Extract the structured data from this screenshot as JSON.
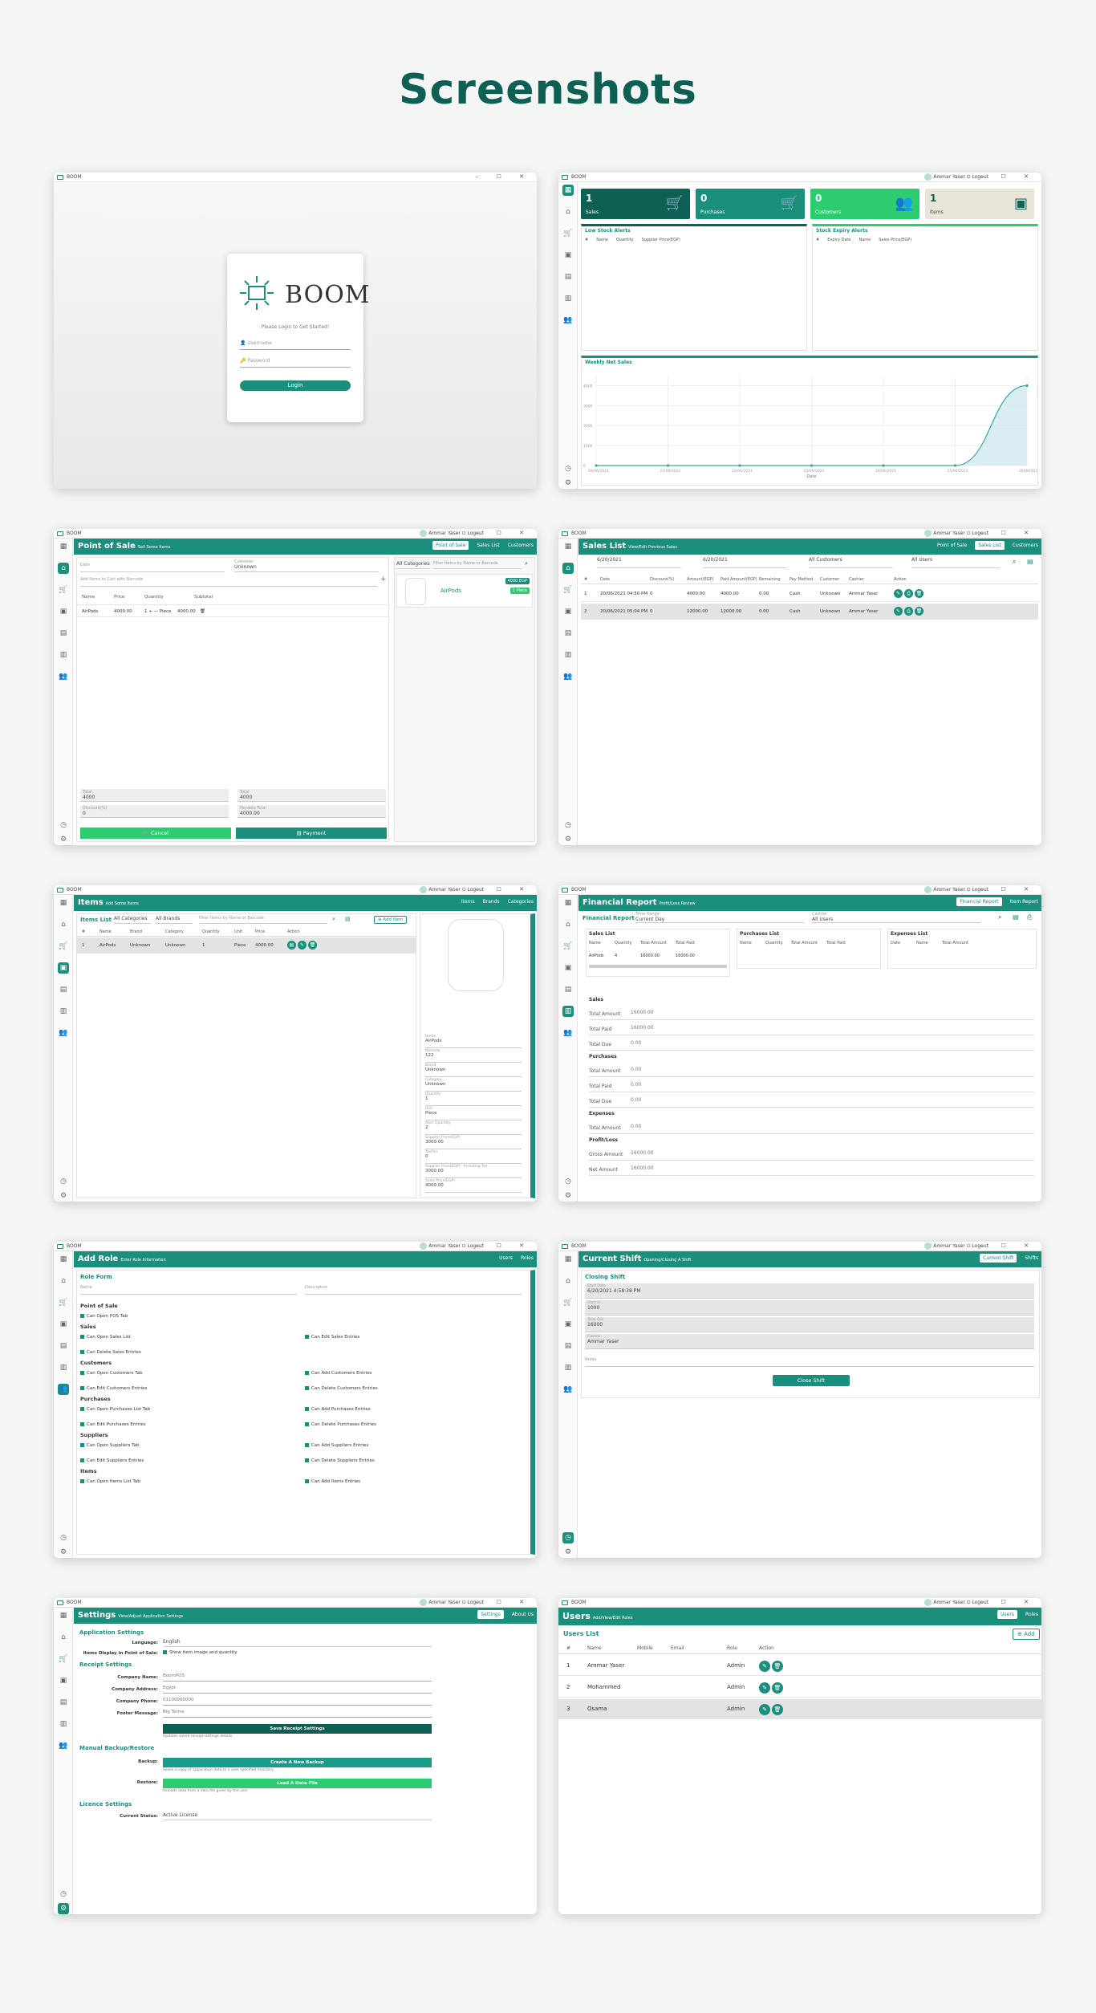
{
  "page_title": "Screenshots",
  "app": {
    "window_title": "BOOM",
    "user": "Ammar Yaser",
    "logout": "Logout",
    "window_controls": "–  ☐  ✕"
  },
  "login": {
    "logo_text": "BOOM",
    "message": "Please Login to Get Started!",
    "username_placeholder": "Username",
    "password_placeholder": "Password",
    "login_button": "Login"
  },
  "dashboard": {
    "cards": [
      {
        "value": "1",
        "label": "Sales",
        "color": "#0e5f54"
      },
      {
        "value": "0",
        "label": "Purchases",
        "color": "#1a8f7c"
      },
      {
        "value": "0",
        "label": "Customers",
        "color": "#2ecc71"
      },
      {
        "value": "1",
        "label": "Items",
        "color": "#e8e4d8"
      }
    ],
    "low_stock": {
      "title": "Low Stock Alerts",
      "columns": [
        "#",
        "Name",
        "Quantity",
        "Supplier Price(EGP)"
      ]
    },
    "expiry": {
      "title": "Stock Expiry Alerts",
      "columns": [
        "#",
        "Expiry Date",
        "Name",
        "Sales Price(EGP)"
      ]
    },
    "chart_title": "Weekly Net Sales",
    "x_label": "Date",
    "y_ticks": [
      "4000",
      "3000",
      "2000",
      "1000",
      "0"
    ]
  },
  "chart_data": {
    "type": "line",
    "title": "Weekly Net Sales",
    "xlabel": "Date",
    "ylabel": "",
    "x": [
      "20/06/2021",
      "21/06/2021",
      "22/06/2021",
      "23/06/2021",
      "24/06/2021",
      "25/06/2021",
      "26/06/2021"
    ],
    "values": [
      0,
      0,
      0,
      0,
      0,
      0,
      4000
    ],
    "ylim": [
      0,
      4500
    ]
  },
  "pos": {
    "title": "Point of Sale",
    "subtitle": "Sell Some Items",
    "nav": [
      "Point of Sale",
      "Sales List",
      "Customers"
    ],
    "date_placeholder": "Date",
    "customer_label": "Customer",
    "customer_value": "Unknown",
    "barcode_placeholder": "Add Items to Cart with Barcode",
    "columns": [
      "Name",
      "Price",
      "Quantity",
      "Subtotal"
    ],
    "row": {
      "name": "AirPods",
      "price": "4000.00",
      "qty": "1",
      "unit": "Piece",
      "subtotal": "4000.00"
    },
    "category": "All Categories",
    "search_placeholder": "Filter Items by Name or Barcode",
    "item": {
      "name": "AirPods",
      "price": "4000 EGP",
      "stock": "1 Piece"
    },
    "totals": {
      "total_label": "Total",
      "total": "4000",
      "discount_label": "Discount(%)",
      "discount": "0",
      "payable_label": "Payable Total",
      "payable": "4000.00"
    },
    "cancel": "Cancel",
    "payment": "Payment"
  },
  "sales": {
    "title": "Sales List",
    "subtitle": "View/Edit Previous Sales",
    "nav": [
      "Point of Sale",
      "Sales List",
      "Customers"
    ],
    "from": "6/20/2021",
    "to": "6/20/2021",
    "customer": "All Customers",
    "cashier": "All Users",
    "columns": [
      "#",
      "Date",
      "Discount(%)",
      "Amount(EGP)",
      "Paid Amount(EGP)",
      "Remaining",
      "Pay Method",
      "Customer",
      "Cashier",
      "Action"
    ],
    "rows": [
      [
        "1",
        "20/06/2021 04:50 PM",
        "0",
        "4000.00",
        "4000.00",
        "0.00",
        "Cash",
        "Unknown",
        "Ammar Yaser"
      ],
      [
        "2",
        "20/06/2021 05:04 PM",
        "0",
        "12000.00",
        "12000.00",
        "0.00",
        "Cash",
        "Unknown",
        "Ammar Yaser"
      ]
    ]
  },
  "items": {
    "title": "Items",
    "subtitle": "Add Some Items",
    "nav": [
      "Items",
      "Brands",
      "Categories"
    ],
    "list_title": "Items List",
    "category": "All Categories",
    "brand": "All Brands",
    "search_placeholder": "Filter Items by Name or Barcode",
    "add_button": "Add Item",
    "columns": [
      "#",
      "Name",
      "Brand",
      "Category",
      "Quantity",
      "Unit",
      "Price",
      "Action"
    ],
    "row": [
      "1",
      "AirPods",
      "Unknown",
      "Unknown",
      "1",
      "Piece",
      "4000.00"
    ],
    "details": [
      {
        "label": "Name",
        "value": "AirPods"
      },
      {
        "label": "Barcode",
        "value": "122"
      },
      {
        "label": "Brand",
        "value": "Unknown"
      },
      {
        "label": "Category",
        "value": "Unknown"
      },
      {
        "label": "Quantity",
        "value": "1"
      },
      {
        "label": "Unit",
        "value": "Piece"
      },
      {
        "label": "Alert Quantity",
        "value": "2"
      },
      {
        "label": "Supplier Price(EGP)",
        "value": "3000.00"
      },
      {
        "label": "Tax(%)",
        "value": "0"
      },
      {
        "label": "Supplier Price(EGP) - Including Tax",
        "value": "3000.00"
      },
      {
        "label": "Sales Price(EGP)",
        "value": "4000.00"
      }
    ]
  },
  "finance": {
    "title": "Financial Report",
    "subtitle": "Profit/Loss Review",
    "nav": [
      "Financial Report",
      "Item Report"
    ],
    "panel_title": "Financial Report",
    "time_label": "Time Range",
    "time_value": "Current Day",
    "cashier_label": "Cashier",
    "cashier_value": "All Users",
    "sales_list": {
      "title": "Sales List",
      "columns": [
        "Name",
        "Quantity",
        "Total Amount",
        "Total Paid"
      ],
      "row": [
        "AirPods",
        "4",
        "16000.00",
        "16000.00"
      ]
    },
    "purchases_list": {
      "title": "Purchases List",
      "columns": [
        "Name",
        "Quantity",
        "Total Amount",
        "Total Paid"
      ]
    },
    "expenses_list": {
      "title": "Expenses List",
      "columns": [
        "Date",
        "Name",
        "Total Amount"
      ]
    },
    "groups": [
      {
        "title": "Sales",
        "rows": [
          [
            "Total Amount",
            "16000.00"
          ],
          [
            "Total Paid",
            "16000.00"
          ],
          [
            "Total Due",
            "0.00"
          ]
        ]
      },
      {
        "title": "Purchases",
        "rows": [
          [
            "Total Amount",
            "0.00"
          ],
          [
            "Total Paid",
            "0.00"
          ],
          [
            "Total Due",
            "0.00"
          ]
        ]
      },
      {
        "title": "Expenses",
        "rows": [
          [
            "Total Amount",
            "0.00"
          ]
        ]
      },
      {
        "title": "Profit/Loss",
        "rows": [
          [
            "Gross Amount",
            "16000.00"
          ],
          [
            "Net Amount",
            "16000.00"
          ]
        ]
      }
    ]
  },
  "role": {
    "title": "Add Role",
    "subtitle": "Enter Role Information",
    "nav": [
      "Users",
      "Roles"
    ],
    "form_title": "Role Form",
    "name_placeholder": "Name",
    "desc_placeholder": "Description",
    "groups": [
      {
        "title": "Point of Sale",
        "items": [
          "Can Open POS Tab"
        ]
      },
      {
        "title": "Sales",
        "items": [
          "Can Open Sales List",
          "Can Edit Sales Entries",
          "Can Delete Sales Entries"
        ]
      },
      {
        "title": "Customers",
        "items": [
          "Can Open Customers Tab",
          "Can Add Customers Entries",
          "Can Edit Customers Entries",
          "Can Delete Customers Entries"
        ]
      },
      {
        "title": "Purchases",
        "items": [
          "Can Open Purchases List Tab",
          "Can Add Purchases Entries",
          "Can Edit Purchases Entries",
          "Can Delete Purchases Entries"
        ]
      },
      {
        "title": "Suppliers",
        "items": [
          "Can Open Suppliers Tab",
          "Can Add Suppliers Entries",
          "Can Edit Suppliers Entries",
          "Can Delete Suppliers Entries"
        ]
      },
      {
        "title": "Items",
        "items": [
          "Can Open Items List Tab",
          "Can Add Items Entries"
        ]
      }
    ]
  },
  "shift": {
    "title": "Current Shift",
    "subtitle": "Opening/Closing A Shift",
    "nav": [
      "Current Shift",
      "Shifts"
    ],
    "panel_title": "Closing Shift",
    "fields": [
      {
        "label": "Start Date",
        "value": "6/20/2021 4:58:38 PM"
      },
      {
        "label": "Start In",
        "value": "1000"
      },
      {
        "label": "Total Out",
        "value": "16000"
      },
      {
        "label": "Cashier",
        "value": "Ammar Yaser"
      }
    ],
    "notes_placeholder": "Notes",
    "button": "Close Shift"
  },
  "settings": {
    "title": "Settings",
    "subtitle": "View/Adjust Application Settings",
    "nav": [
      "Settings",
      "About Us"
    ],
    "app_section": "Application Settings",
    "language_label": "Language:",
    "language": "English",
    "items_display_label": "Items Display in Point of Sale:",
    "items_display": "Show item image and quantity",
    "receipt_section": "Receipt Settings",
    "receipt_fields": [
      {
        "label": "Company Name:",
        "value": "BoomPOS"
      },
      {
        "label": "Company Address:",
        "value": "Egypt"
      },
      {
        "label": "Company Phone:",
        "value": "01100000000"
      },
      {
        "label": "Footer Message:",
        "value": "Big Terms"
      }
    ],
    "save_button": "Save Receipt Settings",
    "save_hint": "Updates saved receipt settings details",
    "backup_section": "Manual Backup/Restore",
    "backup_label": "Backup:",
    "backup_button": "Create A New Backup",
    "backup_hint": "Saves a copy of application data to a user specified directory",
    "restore_label": "Restore:",
    "restore_button": "Load A Data File",
    "restore_hint": "Reloads data from a data file given by the user",
    "licence_section": "Licence Settings",
    "status_label": "Current Status:",
    "status": "Active License"
  },
  "users": {
    "title": "Users",
    "subtitle": "Add/View/Edit Roles",
    "nav": [
      "Users",
      "Roles"
    ],
    "list_title": "Users List",
    "add_button": "Add",
    "columns": [
      "#",
      "Name",
      "Mobile",
      "Email",
      "Role",
      "Action"
    ],
    "rows": [
      [
        "1",
        "Ammar Yaser",
        "Admin"
      ],
      [
        "2",
        "Mohammed",
        "Admin"
      ],
      [
        "3",
        "Osama",
        "Admin"
      ]
    ]
  }
}
